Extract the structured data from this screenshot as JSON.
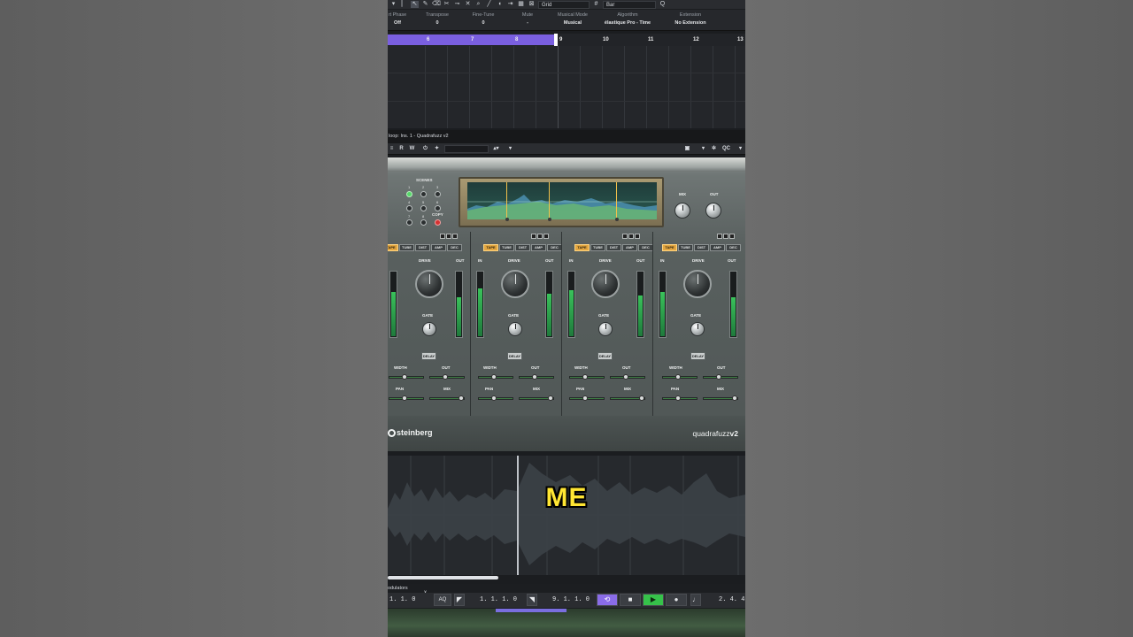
{
  "toolbar": {
    "snap_mode": "Grid",
    "grid_type": "Bar",
    "qc_label": "QC"
  },
  "infoline": [
    {
      "label": "rt Phase",
      "value": "Off"
    },
    {
      "label": "Transpose",
      "value": "0"
    },
    {
      "label": "Fine-Tune",
      "value": "0"
    },
    {
      "label": "Mute",
      "value": "-"
    },
    {
      "label": "Musical Mode",
      "value": "Musical"
    },
    {
      "label": "Algorithm",
      "value": "élastique Pro - Time"
    },
    {
      "label": "Extension",
      "value": "No Extension"
    }
  ],
  "ruler": {
    "bars": [
      "6",
      "7",
      "8",
      "9",
      "10",
      "11",
      "12",
      "13"
    ]
  },
  "plugin_window": {
    "title": "loop: Ins. 1 - Quadrafuzz v2",
    "read_label": "R",
    "write_label": "W",
    "qc_label": "QC"
  },
  "plugin": {
    "scenes_label": "SCENES",
    "scene_numbers": [
      "1",
      "2",
      "3",
      "4",
      "5",
      "6",
      "7",
      "8"
    ],
    "copy_label": "COPY",
    "mix_label": "MIX",
    "out_label": "OUT",
    "brand": "steinberg",
    "product_prefix": "quadrafuzz",
    "product_suffix": "v2",
    "band_modes": [
      "TAPE",
      "TUBE",
      "DIST",
      "AMP",
      "DEC"
    ],
    "band_labels": {
      "in": "IN",
      "drive": "DRIVE",
      "out": "OUT",
      "gate": "GATE",
      "delay": "DELAY",
      "width": "WIDTH",
      "pan": "PAN",
      "mix": "MIX"
    }
  },
  "caption": "ME",
  "bottom": {
    "modulators_label": "odulators",
    "close_label": "x",
    "left_position": "1. 1. 0",
    "aq_label": "AQ",
    "left_locator": "1. 1. 1. 0",
    "right_locator": "9. 1. 1. 0",
    "right_display": "2. 4. 4"
  },
  "colors": {
    "cycle": "#7a5fe0",
    "caption": "#ffe633",
    "play": "#36c24a",
    "mode_selected": "#e3a640"
  }
}
